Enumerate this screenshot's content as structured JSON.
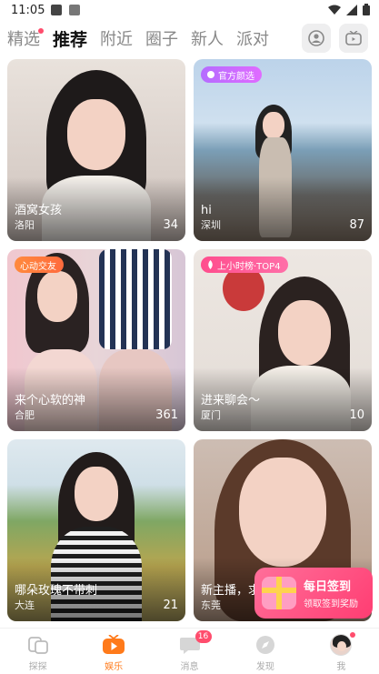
{
  "status_bar": {
    "time": "11:05",
    "icons": [
      "notification-icon",
      "a-icon",
      "wifi-icon",
      "signal-icon",
      "battery-icon"
    ]
  },
  "tabs": [
    {
      "label": "精选",
      "active": false,
      "dot": true
    },
    {
      "label": "推荐",
      "active": true,
      "dot": false
    },
    {
      "label": "附近",
      "active": false,
      "dot": false
    },
    {
      "label": "圈子",
      "active": false,
      "dot": false
    },
    {
      "label": "新人",
      "active": false,
      "dot": false
    },
    {
      "label": "派对",
      "active": false,
      "dot": false
    }
  ],
  "top_buttons": [
    "profile-circle-icon",
    "tv-icon"
  ],
  "cards": [
    {
      "name": "酒窝女孩",
      "location": "洛阳",
      "count": "34",
      "badge": ""
    },
    {
      "name": "hi",
      "location": "深圳",
      "count": "87",
      "badge": "官方颜选"
    },
    {
      "name": "来个心软的神",
      "location": "合肥",
      "count": "361",
      "badge": "心动交友"
    },
    {
      "name": "进来聊会～",
      "location": "厦门",
      "count": "10",
      "badge": "上小时榜·TOP4"
    },
    {
      "name": "哪朵玫瑰不带刺",
      "location": "大连",
      "count": "21",
      "badge": ""
    },
    {
      "name": "新主播，求",
      "location": "东莞",
      "count": "",
      "badge": ""
    }
  ],
  "checkin": {
    "title": "每日签到",
    "subtitle": "领取签到奖励"
  },
  "bottom_nav": [
    {
      "label": "探探",
      "icon": "explore-icon",
      "active": false,
      "badge": ""
    },
    {
      "label": "娱乐",
      "icon": "play-icon",
      "active": true,
      "badge": ""
    },
    {
      "label": "消息",
      "icon": "message-icon",
      "active": false,
      "badge": "16"
    },
    {
      "label": "发现",
      "icon": "compass-icon",
      "active": false,
      "badge": ""
    },
    {
      "label": "我",
      "icon": "avatar-icon",
      "active": false,
      "badge": ""
    }
  ],
  "colors": {
    "accent": "#ff7a1a",
    "badge_pink": "#ff4d6d",
    "badge_purple": "#b56cff",
    "badge_orange": "#ff8a3d"
  }
}
